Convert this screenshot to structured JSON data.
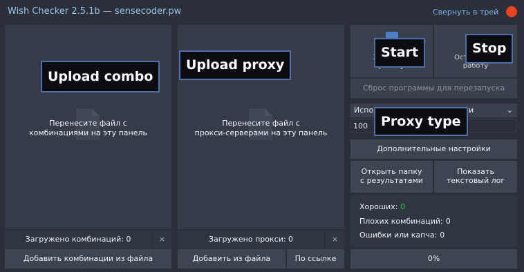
{
  "window": {
    "title": "Wish Checker 2.5.1b — sensecoder.pw",
    "minimize_to_tray": "Свернуть в трей",
    "close_color": "#e9431f",
    "accent_color": "#7fb2e6"
  },
  "combo_panel": {
    "drop_text_line1": "Перенесите файл с",
    "drop_text_line2": "комбинациями на эту панель",
    "icon": "file-icon",
    "loaded_count": "Загружено комбинаций: 0",
    "clear_label": "×",
    "add_button": "Добавить комбинации из файла",
    "overlay_label": "Upload combo"
  },
  "proxy_panel": {
    "drop_text_line1": "Перенесите файл с",
    "drop_text_line2": "прокси-серверами на эту панель",
    "icon": "file-icon",
    "loaded_count": "Загружено прокси: 0",
    "clear_label": "×",
    "add_from_file_button": "Добавить из файла",
    "by_link_button": "По ссылке",
    "overlay_label": "Upload proxy"
  },
  "controls": {
    "start_ghost_line1": "Запустить",
    "start_ghost_line2": "работу",
    "stop_ghost_line1": "Остановить",
    "stop_ghost_line2": "работу",
    "start_overlay": "Start",
    "stop_overlay": "Stop",
    "reset_button": "Сброс программы для перезапуска",
    "proxy_type_value": "Использовать SOCKS4-прокси",
    "proxy_type_overlay": "Proxy type",
    "threads_value": "100",
    "advanced_settings_button": "Дополнительные настройки",
    "open_results_line1": "Открыть папку",
    "open_results_line2": "с результатами",
    "show_log_line1": "Показать",
    "show_log_line2": "текстовый лог"
  },
  "stats": {
    "good_label": "Хороших:",
    "good_value": "0",
    "good_color": "#33cc44",
    "bad_label": "Плохих комбинаций:",
    "bad_value": "0",
    "errors_label": "Ошибки или капча:",
    "errors_value": "0"
  },
  "progress": {
    "label": "0%",
    "fraction": 0
  }
}
